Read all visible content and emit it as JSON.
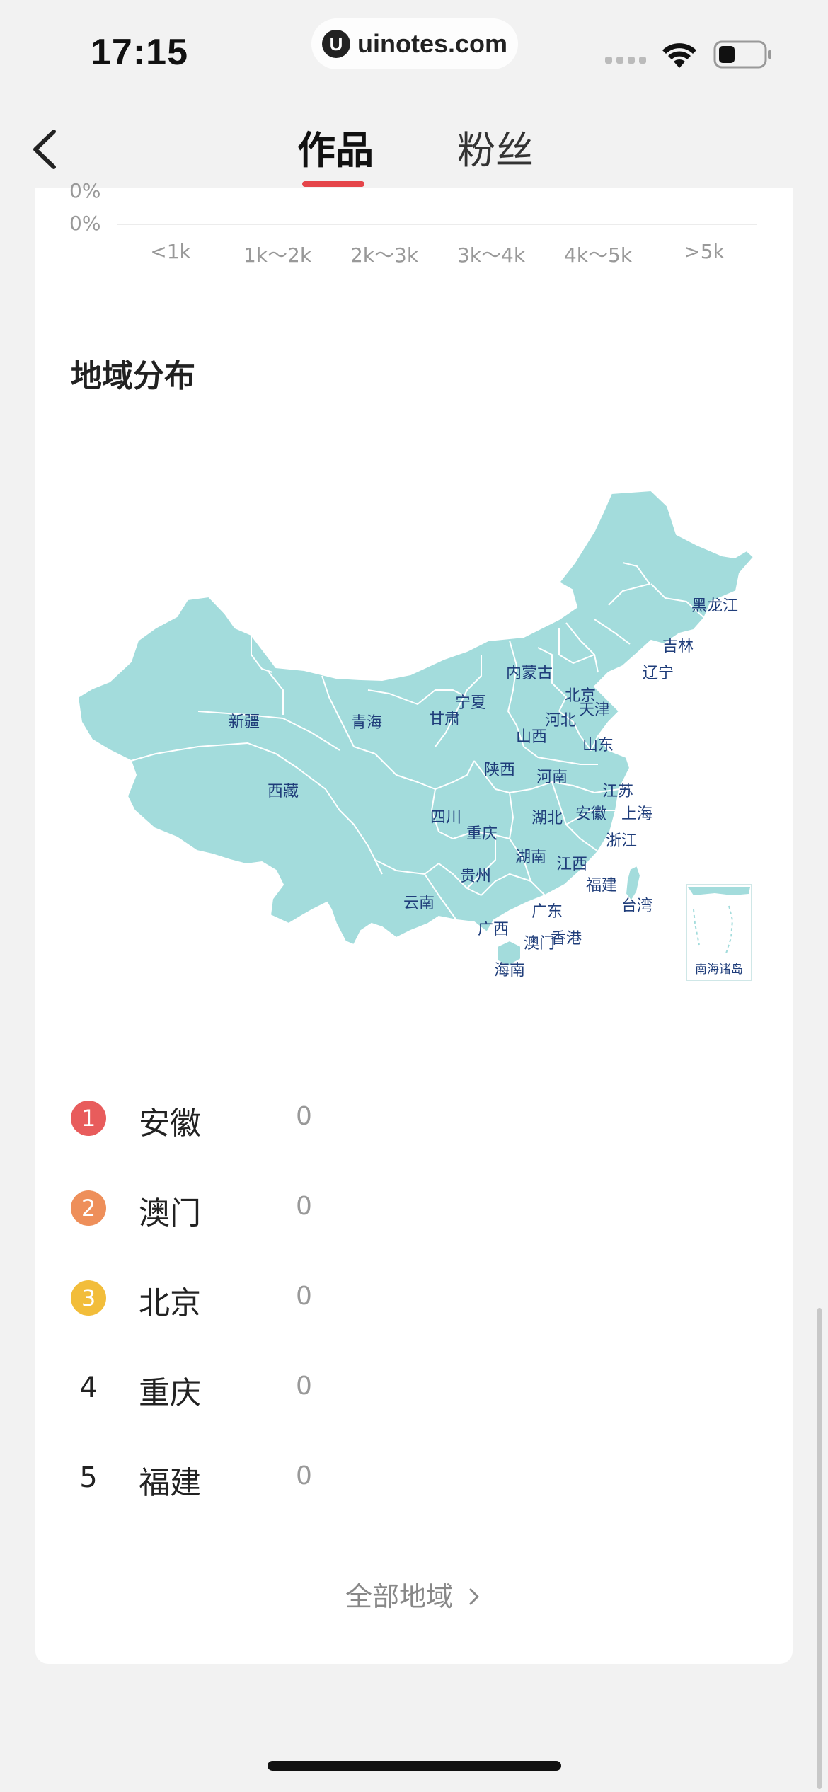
{
  "status_bar": {
    "time": "17:15",
    "url": "uinotes.com",
    "url_logo_letter": "U",
    "icons": [
      "signal-icon",
      "wifi-icon",
      "battery-icon"
    ]
  },
  "nav": {
    "back_icon": "chevron-left-icon",
    "tabs": [
      {
        "label": "作品",
        "active": true
      },
      {
        "label": "粉丝",
        "active": false
      }
    ],
    "accent_color": "#e5454a"
  },
  "price_chart": {
    "y_labels": [
      "0%",
      "0%"
    ],
    "x_labels": [
      "<1k",
      "1k～2k",
      "2k～3k",
      "3k～4k",
      "4k～5k",
      ">5k"
    ]
  },
  "region": {
    "title": "地域分布",
    "map_color": "#a3dcdc",
    "map_labels": [
      "新疆",
      "西藏",
      "青海",
      "甘肃",
      "宁夏",
      "内蒙古",
      "黑龙江",
      "吉林",
      "辽宁",
      "北京",
      "天津",
      "河北",
      "山西",
      "山东",
      "陕西",
      "河南",
      "江苏",
      "安徽",
      "上海",
      "四川",
      "重庆",
      "湖北",
      "浙江",
      "湖南",
      "江西",
      "贵州",
      "福建",
      "云南",
      "广西",
      "广东",
      "台湾",
      "澳门",
      "香港",
      "海南",
      "南海诸岛"
    ],
    "ranking": [
      {
        "rank": "1",
        "name": "安徽",
        "value": "0",
        "badge_color": "#e85c5c"
      },
      {
        "rank": "2",
        "name": "澳门",
        "value": "0",
        "badge_color": "#ee8f5a"
      },
      {
        "rank": "3",
        "name": "北京",
        "value": "0",
        "badge_color": "#f2bd3a"
      },
      {
        "rank": "4",
        "name": "重庆",
        "value": "0",
        "badge_color": ""
      },
      {
        "rank": "5",
        "name": "福建",
        "value": "0",
        "badge_color": ""
      }
    ],
    "all_regions_label": "全部地域"
  }
}
